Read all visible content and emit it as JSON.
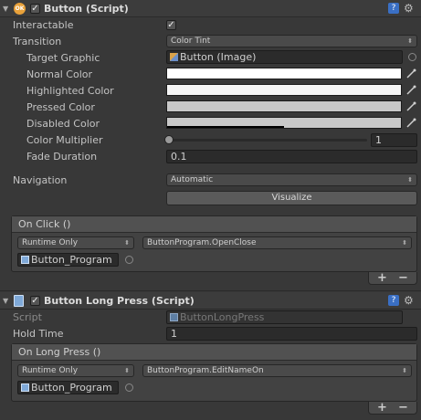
{
  "button_component": {
    "title": "Button (Script)",
    "enabled": true,
    "interactable": {
      "label": "Interactable",
      "checked": true
    },
    "transition": {
      "label": "Transition",
      "value": "Color Tint"
    },
    "target_graphic": {
      "label": "Target Graphic",
      "value": "Button (Image)"
    },
    "normal_color": {
      "label": "Normal Color",
      "hex": "#ffffff"
    },
    "highlighted_color": {
      "label": "Highlighted Color",
      "hex": "#f5f5f5"
    },
    "pressed_color": {
      "label": "Pressed Color",
      "hex": "#c8c8c8"
    },
    "disabled_color": {
      "label": "Disabled Color",
      "hex": "#c8c8c8"
    },
    "color_multiplier": {
      "label": "Color Multiplier",
      "value": "1",
      "slider_fraction": 0.0
    },
    "fade_duration": {
      "label": "Fade Duration",
      "value": "0.1"
    },
    "navigation": {
      "label": "Navigation",
      "value": "Automatic"
    },
    "visualize_button": "Visualize",
    "on_click": {
      "title": "On Click ()",
      "runtime": "Runtime Only",
      "function": "ButtonProgram.OpenClose",
      "object": "Button_Program"
    }
  },
  "long_press_component": {
    "title": "Button Long Press (Script)",
    "script": {
      "label": "Script",
      "value": "ButtonLongPress"
    },
    "hold_time": {
      "label": "Hold Time",
      "value": "1"
    },
    "on_long_press": {
      "title": "On Long Press ()",
      "runtime": "Runtime Only",
      "function": "ButtonProgram.EditNameOn",
      "object": "Button_Program"
    }
  },
  "glyphs": {
    "plus": "+",
    "minus": "−",
    "check": "✓",
    "dropdown_arrow": "⬍"
  },
  "colors": {
    "panel": "#383838",
    "header": "#3c3c3c",
    "event_box": "#424242",
    "help_blue": "#3a6fc4"
  }
}
